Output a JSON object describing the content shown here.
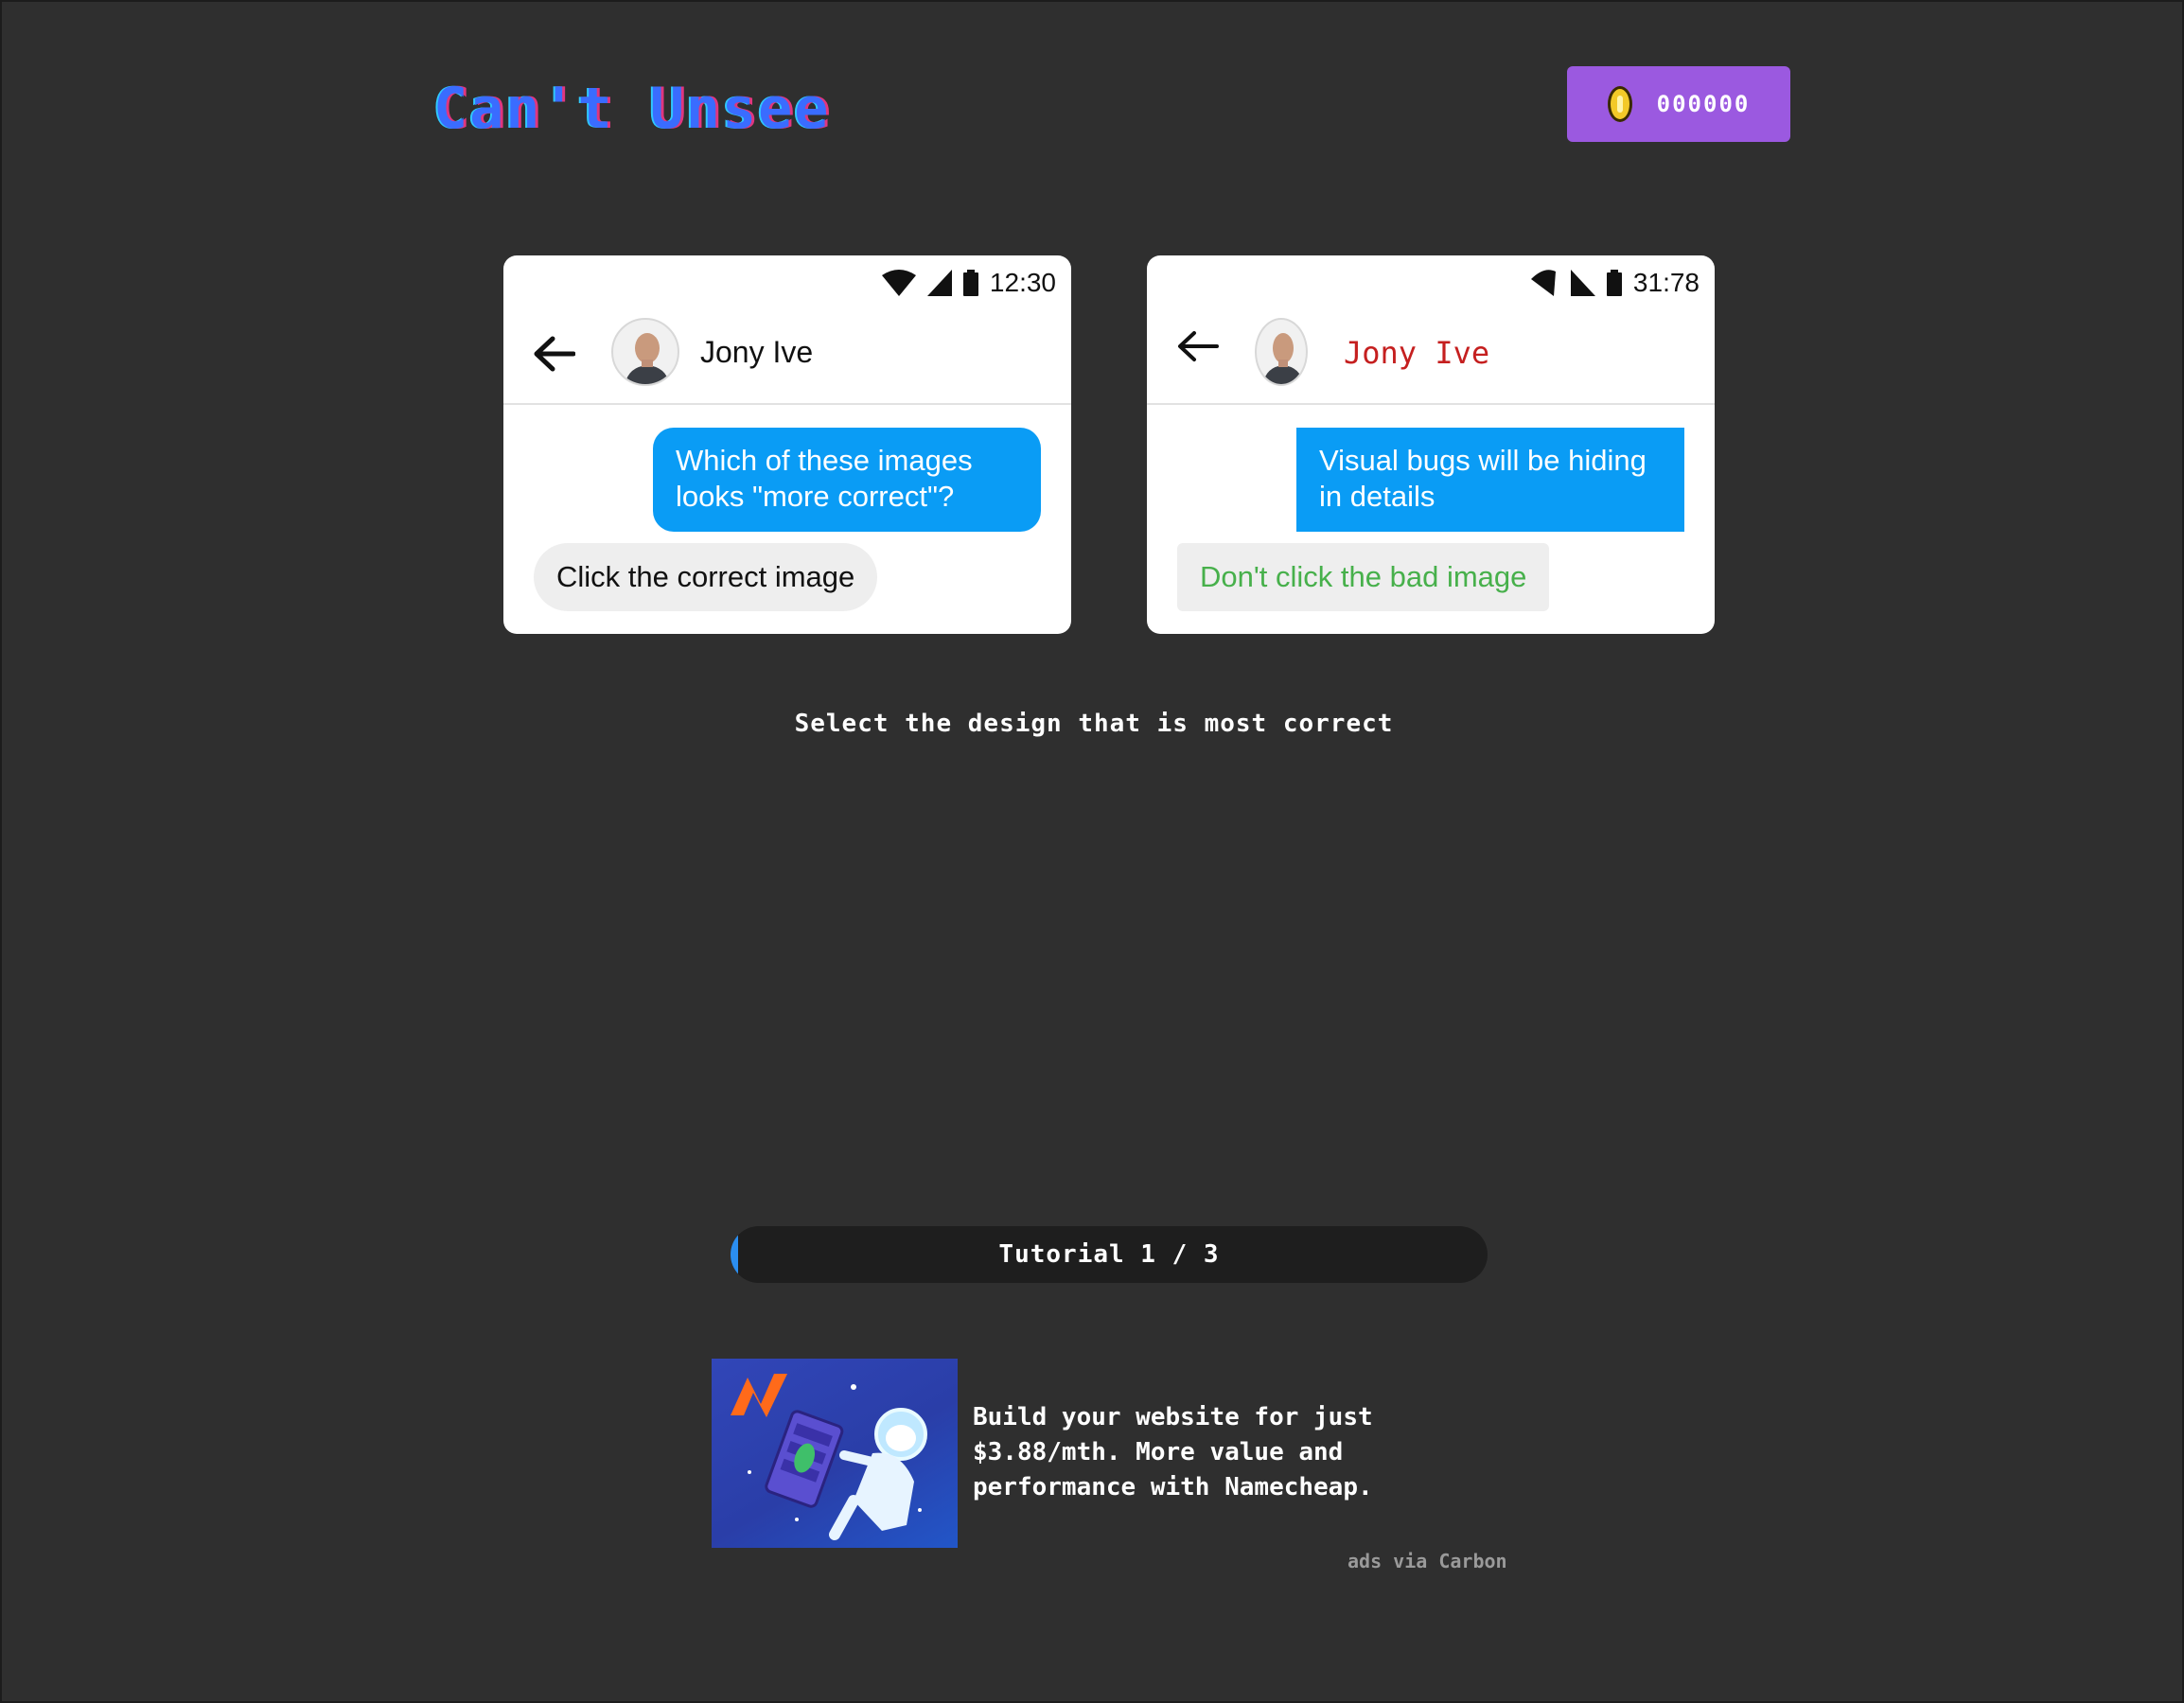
{
  "header": {
    "logo_text": "Can't Unsee",
    "coin_count": "000000"
  },
  "cards": {
    "left": {
      "status_time": "12:30",
      "contact_name": "Jony Ive",
      "outgoing_message": "Which of these images looks \"more correct\"?",
      "incoming_message": "Click the correct image"
    },
    "right": {
      "status_time": "31:78",
      "contact_name": "Jony Ive",
      "outgoing_message": "Visual bugs will be hiding in details",
      "incoming_message": "Don't click the bad image"
    }
  },
  "instruction": "Select the design that is most correct",
  "progress": {
    "label": "Tutorial 1 / 3",
    "fraction": 0.01
  },
  "ad": {
    "text": "Build your website for just $3.88/mth. More value and performance with Namecheap.",
    "credit": "ads via Carbon"
  },
  "colors": {
    "background": "#2f2f2f",
    "coin_button": "#9b59e0",
    "bubble_blue": "#0a9cf5",
    "correct_green": "#47b04b",
    "wrong_red": "#c51f1f",
    "progress_fill": "#2b8ef0"
  },
  "icons": [
    "coin-icon",
    "wifi-icon",
    "signal-icon",
    "battery-icon",
    "back-arrow-icon",
    "avatar"
  ]
}
